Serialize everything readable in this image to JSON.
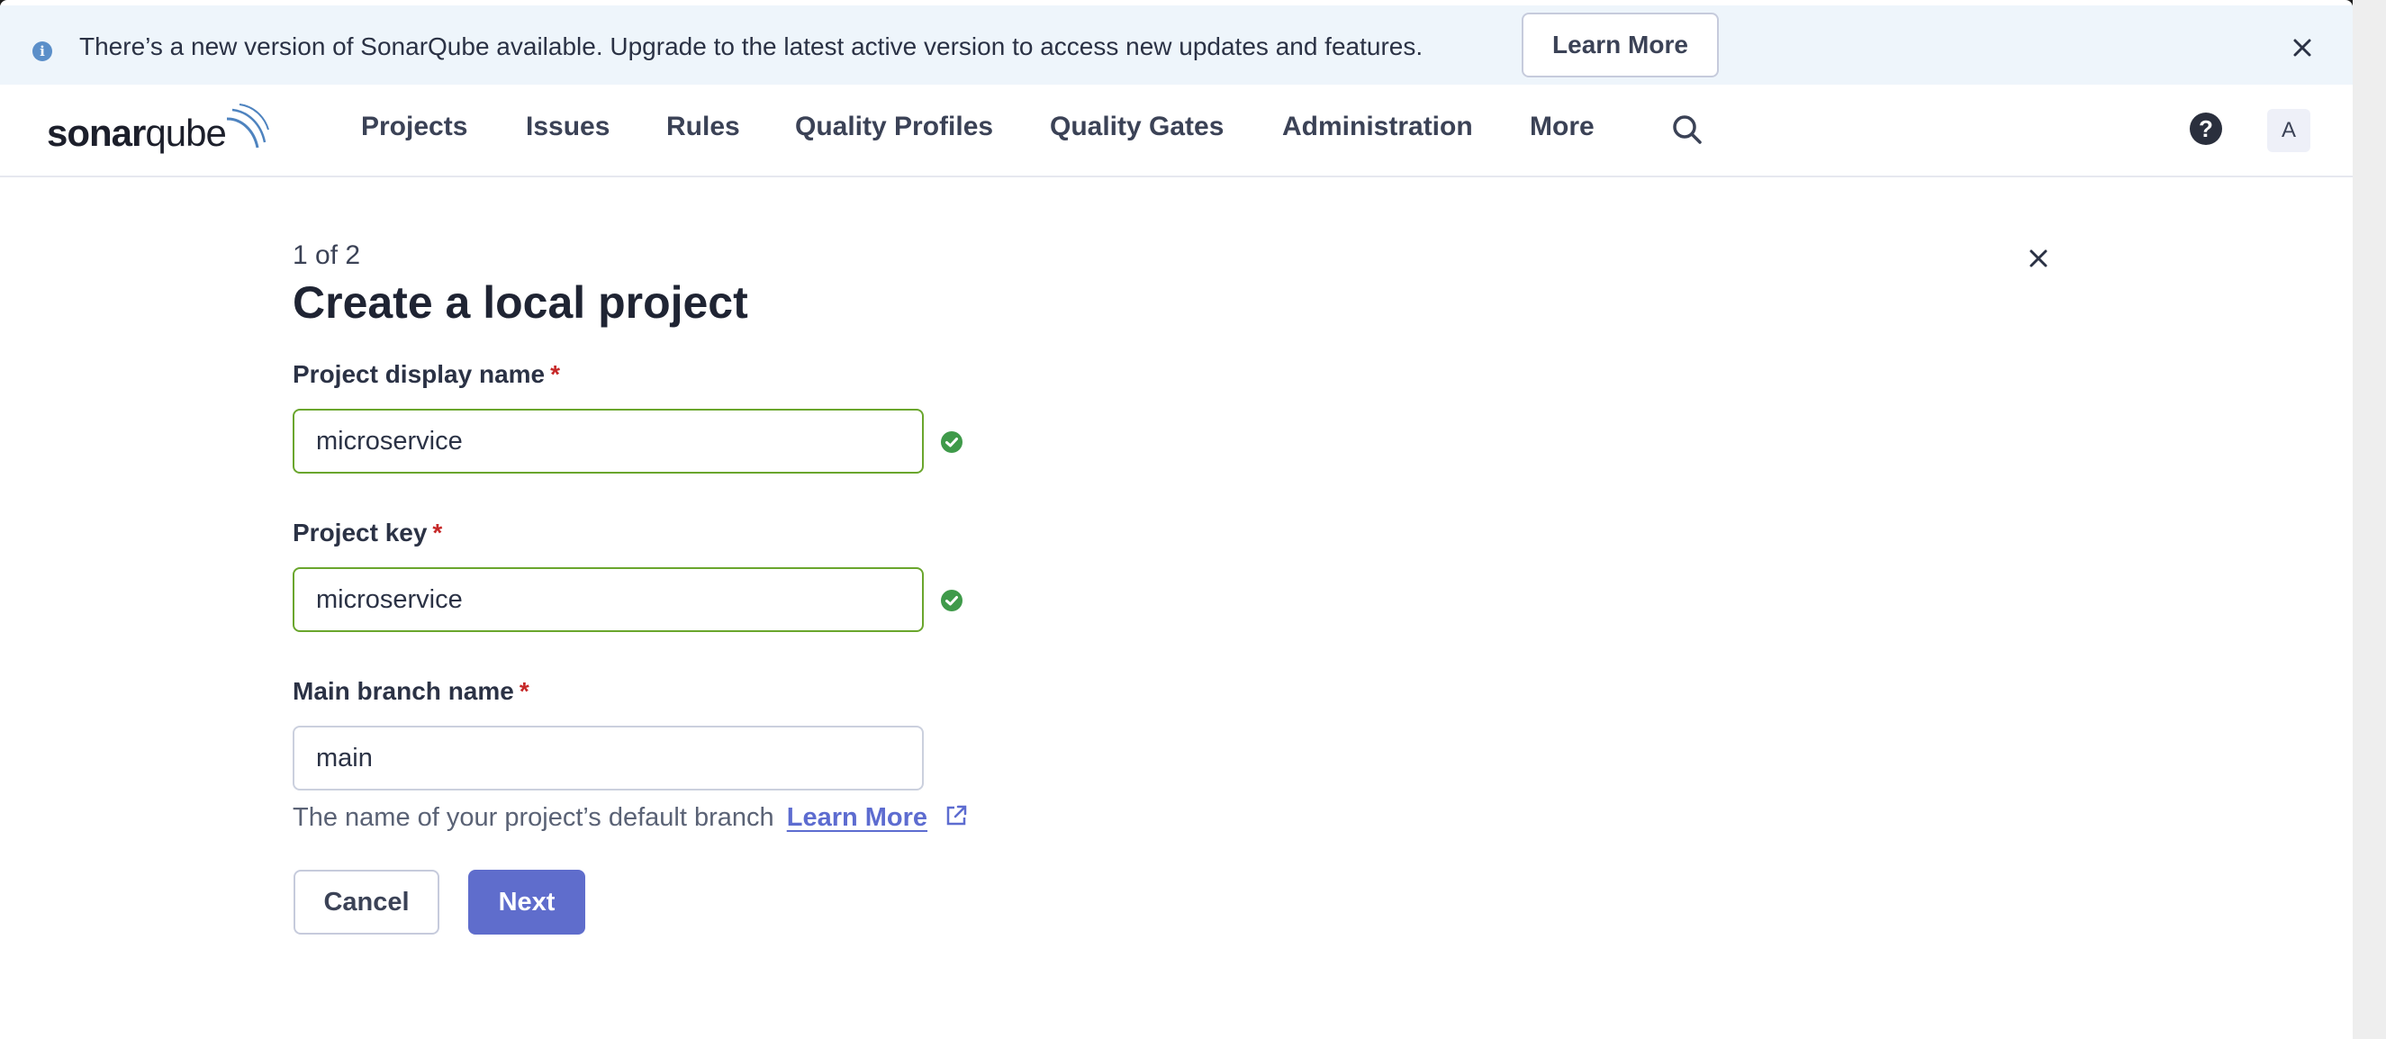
{
  "banner": {
    "message": "There’s a new version of SonarQube available. Upgrade to the latest active version to access new updates and features.",
    "learn_more": "Learn More",
    "info_icon": "info-icon",
    "close_icon": "close-icon"
  },
  "nav": {
    "logo_text_bold": "sonar",
    "logo_text_light": "qube",
    "items": [
      "Projects",
      "Issues",
      "Rules",
      "Quality Profiles",
      "Quality Gates",
      "Administration",
      "More"
    ],
    "search_icon": "search-icon",
    "help_icon": "help-icon",
    "help_glyph": "?",
    "avatar_initial": "A"
  },
  "form": {
    "step": "1 of 2",
    "title": "Create a local project",
    "required_mark": "*",
    "display_name": {
      "label": "Project display name",
      "value": "microservice",
      "status": "valid"
    },
    "project_key": {
      "label": "Project key",
      "value": "microservice",
      "status": "valid"
    },
    "main_branch": {
      "label": "Main branch name",
      "value": "main"
    },
    "helper_text": "The name of your project’s default branch",
    "helper_link": "Learn More",
    "cancel": "Cancel",
    "next": "Next"
  },
  "colors": {
    "accent": "#5f6dcc",
    "valid": "#3f9a4a",
    "valid_border": "#6aa62d",
    "required": "#c62828",
    "banner_bg": "#eef5fb"
  }
}
